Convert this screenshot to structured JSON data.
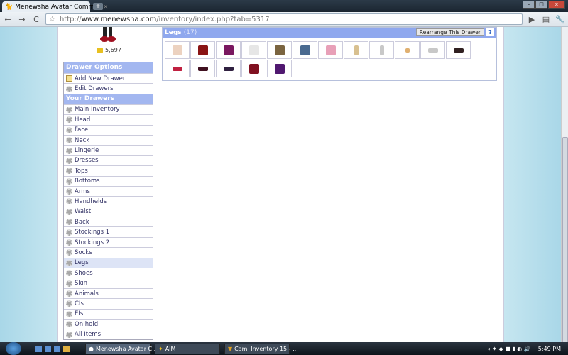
{
  "browser": {
    "tab_title": "Menewsha Avatar Comm...",
    "tab_close": "×",
    "new_tab": "+",
    "url_host": "www.menewsha.com",
    "url_prefix": "http://",
    "url_path": "/inventory/index.php?tab=5317"
  },
  "user": {
    "coins": "5,697"
  },
  "drawer_options": {
    "title": "Drawer Options",
    "items": [
      "Add New Drawer",
      "Edit Drawers"
    ]
  },
  "your_drawers": {
    "title": "Your Drawers",
    "items": [
      "Main Inventory",
      "Head",
      "Face",
      "Neck",
      "Lingerie",
      "Dresses",
      "Tops",
      "Bottoms",
      "Arms",
      "Handhelds",
      "Waist",
      "Back",
      "Stockings 1",
      "Stockings 2",
      "Socks",
      "Legs",
      "Shoes",
      "Skin",
      "Animals",
      "CIs",
      "EIs",
      "On hold",
      "All Items"
    ],
    "selected": "Legs"
  },
  "drawer": {
    "title": "Legs",
    "count": "(17)",
    "rearrange": "Rearrange This Drawer",
    "help": "?",
    "item_colors": [
      "#ecd2c0",
      "#8a1414",
      "#7a1860",
      "#e6e6e6",
      "#7a6440",
      "#4a6a90",
      "#e8a0b8",
      "#d8c090",
      "#c8c8c8",
      "#e0b070",
      "#c8c8c8",
      "#302020",
      "#c02040",
      "#401020",
      "#302040",
      "#801020",
      "#501870"
    ]
  },
  "taskbar": {
    "items": [
      "Menewsha Avatar C...",
      "AIM",
      "Cami Inventory 15 - ..."
    ],
    "time": "5:49 PM"
  }
}
